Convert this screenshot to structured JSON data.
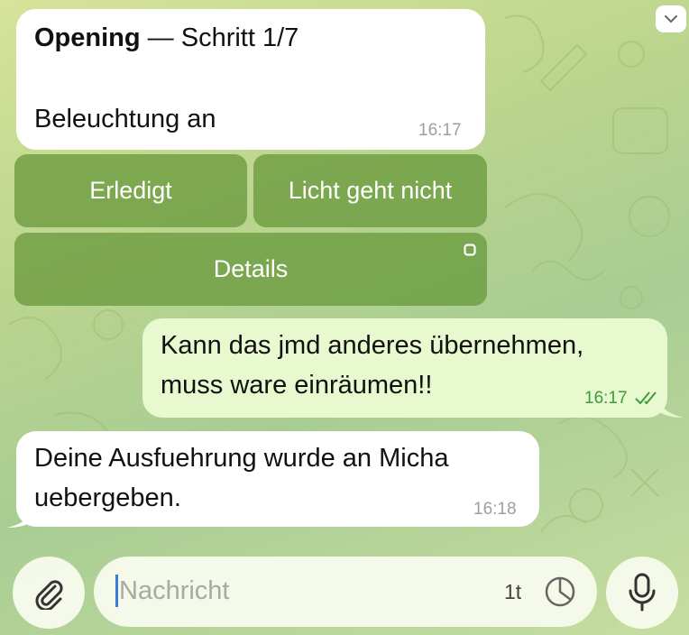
{
  "messages": [
    {
      "title": "Opening",
      "subtitle": "— Schritt 1/7",
      "text": "Beleuchtung an",
      "time": "16:17"
    },
    {
      "text_line1": "Kann das jmd anderes übernehmen,",
      "text_line2": "muss ware einräumen!!",
      "time": "16:17"
    },
    {
      "text_line1": "Deine Ausfuehrung wurde an Micha",
      "text_line2": "uebergeben.",
      "time": "16:18"
    }
  ],
  "keyboard": {
    "done": "Erledigt",
    "light_broken": "Licht geht nicht",
    "details": "Details"
  },
  "composer": {
    "placeholder": "Nachricht",
    "timer_label": "1t"
  },
  "colors": {
    "accent": "#3e9c3a",
    "keyboard_button": "#6a9a3a",
    "outgoing_bubble": "#e8f8cf"
  }
}
